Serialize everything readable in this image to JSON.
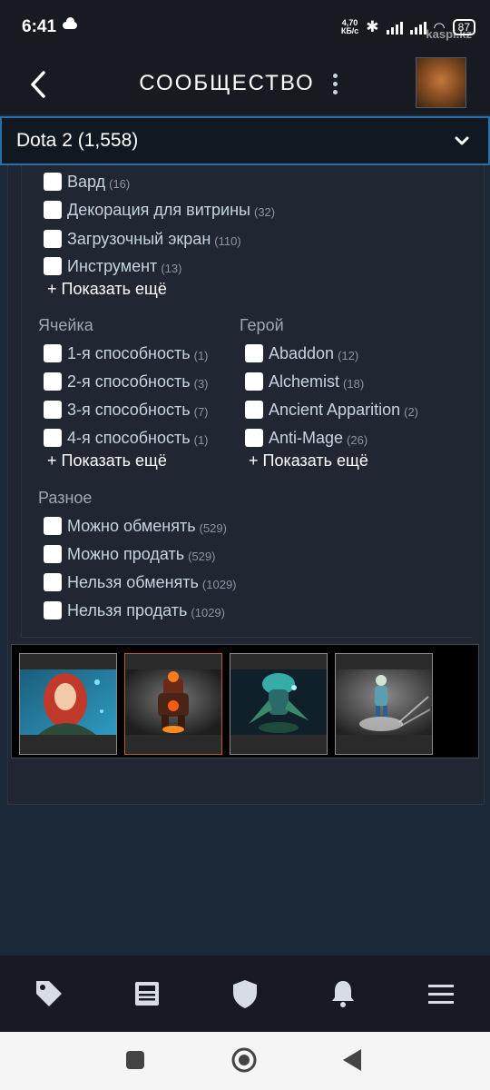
{
  "status_bar": {
    "time": "6:41",
    "net_speed_value": "4,70",
    "net_speed_unit": "КБ/с",
    "battery": "87",
    "watermark": "kaspi.kz"
  },
  "header": {
    "title": "СООБЩЕСТВО"
  },
  "game_select": {
    "selected": "Dota 2 (1,558)"
  },
  "filters": {
    "type_items": [
      {
        "label": "Вард",
        "count": "(16)"
      },
      {
        "label": "Декорация для витрины",
        "count": "(32)"
      },
      {
        "label": "Загрузочный экран",
        "count": "(110)"
      },
      {
        "label": "Инструмент",
        "count": "(13)"
      }
    ],
    "type_show_more": "+ Показать ещё",
    "slot": {
      "title": "Ячейка",
      "items": [
        {
          "label": "1-я способность",
          "count": "(1)"
        },
        {
          "label": "2-я способность",
          "count": "(3)"
        },
        {
          "label": "3-я способность",
          "count": "(7)"
        },
        {
          "label": "4-я способность",
          "count": "(1)"
        }
      ],
      "show_more": "+ Показать ещё"
    },
    "hero": {
      "title": "Герой",
      "items": [
        {
          "label": "Abaddon",
          "count": "(12)"
        },
        {
          "label": "Alchemist",
          "count": "(18)"
        },
        {
          "label": "Ancient Apparition",
          "count": "(2)"
        },
        {
          "label": "Anti-Mage",
          "count": "(26)"
        }
      ],
      "show_more": "+ Показать ещё"
    },
    "misc": {
      "title": "Разное",
      "items": [
        {
          "label": "Можно обменять",
          "count": "(529)"
        },
        {
          "label": "Можно продать",
          "count": "(529)"
        },
        {
          "label": "Нельзя обменять",
          "count": "(1029)"
        },
        {
          "label": "Нельзя продать",
          "count": "(1029)"
        }
      ]
    }
  },
  "items": [
    {
      "icon": "red-haired-hero-item-image",
      "selected": false
    },
    {
      "icon": "fire-golem-item-image",
      "selected": true
    },
    {
      "icon": "crystal-spirit-item-image",
      "selected": false
    },
    {
      "icon": "frost-figure-item-image",
      "selected": false
    }
  ],
  "bottom_nav": [
    "tag-icon",
    "news-icon",
    "shield-icon",
    "bell-icon",
    "menu-icon"
  ],
  "colors": {
    "header_bg": "#171a21",
    "page_bg": "#1b2838",
    "panel_bg": "#212633",
    "dropdown_border": "#2b6fa8",
    "selected_item_border": "#c1572a"
  }
}
